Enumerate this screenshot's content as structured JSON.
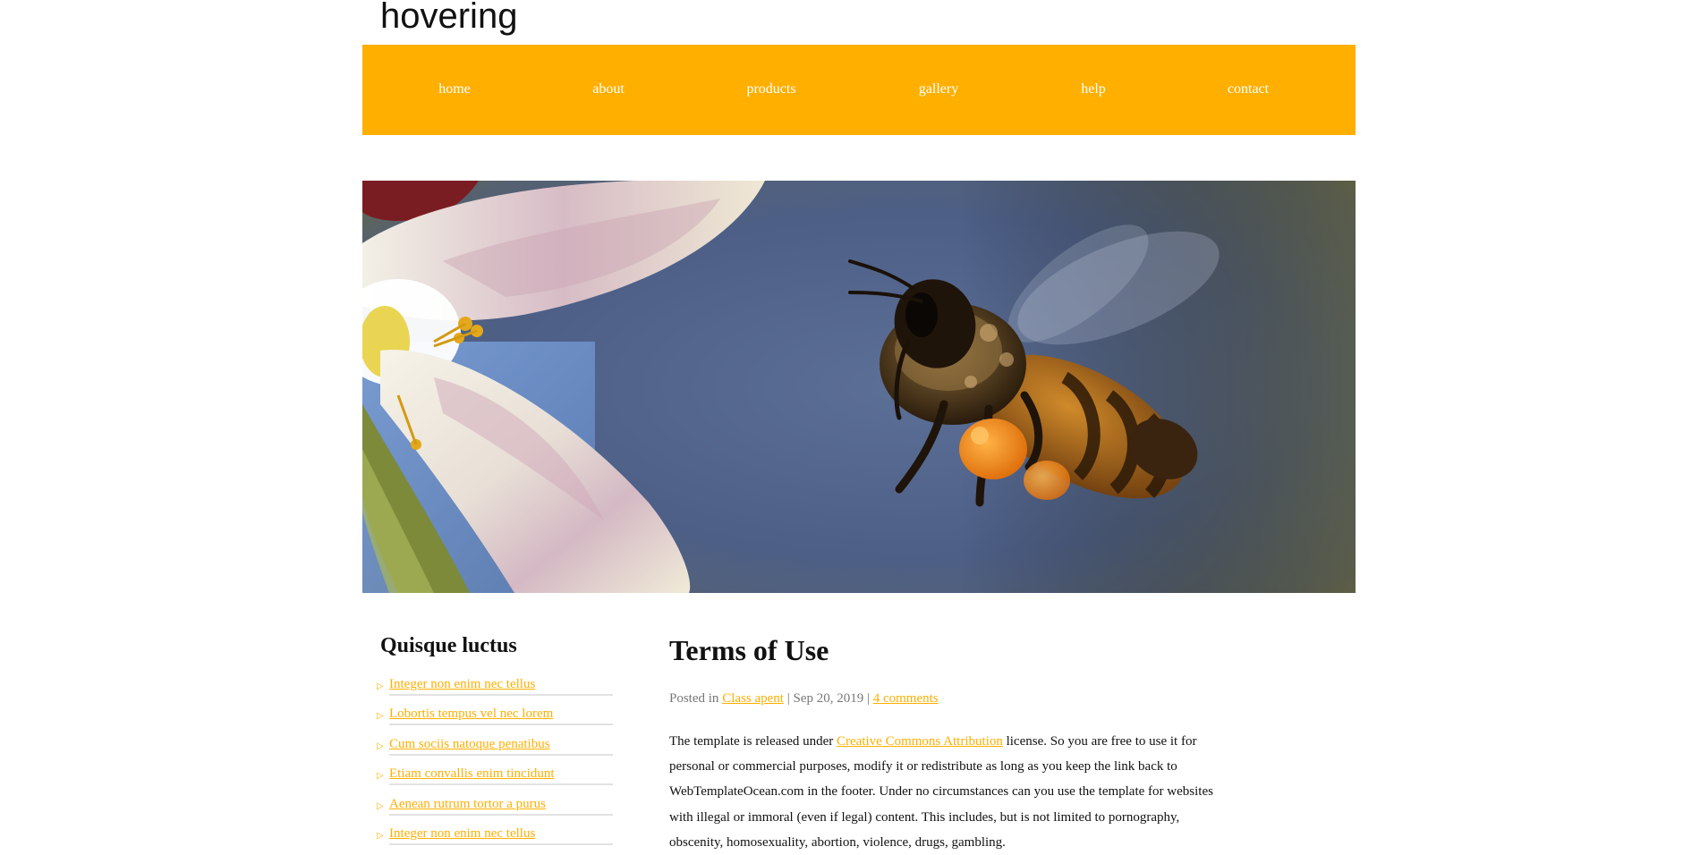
{
  "header": {
    "site_title": "hovering"
  },
  "nav": {
    "items": [
      {
        "label": "home"
      },
      {
        "label": "about"
      },
      {
        "label": "products"
      },
      {
        "label": "gallery"
      },
      {
        "label": "help"
      },
      {
        "label": "contact"
      }
    ]
  },
  "hero": {
    "subject": "bee hovering beside a flower"
  },
  "sidebar": {
    "heading": "Quisque luctus",
    "links": [
      {
        "label": "Integer non enim nec tellus"
      },
      {
        "label": "Lobortis tempus vel nec lorem"
      },
      {
        "label": "Cum sociis natoque penatibus"
      },
      {
        "label": "Etiam convallis enim tincidunt"
      },
      {
        "label": "Aenean rutrum tortor a purus"
      },
      {
        "label": "Integer non enim nec tellus"
      }
    ]
  },
  "post": {
    "title": "Terms of Use",
    "meta": {
      "posted_in": "Posted in",
      "category": "Class apent",
      "sep1": "|",
      "date": "Sep 20, 2019",
      "sep2": "|",
      "comments": "4 comments"
    },
    "body": {
      "before_link": "The template is released under",
      "link": "Creative Commons Attribution",
      "after_link": "license. So you are free to use it for personal or commercial purposes, modify it or redistribute as long as you keep the link back to WebTemplateOcean.com in the footer. Under no circumstances can you use the template for websites with illegal or immoral (even if legal) content. This includes, but is not limited to pornography, obscenity, homosexuality, abortion, violence, drugs, gambling."
    }
  },
  "colors": {
    "accent": "#ffaf00",
    "link": "#ffaf00",
    "text": "#111111",
    "meta_text": "#777777"
  }
}
